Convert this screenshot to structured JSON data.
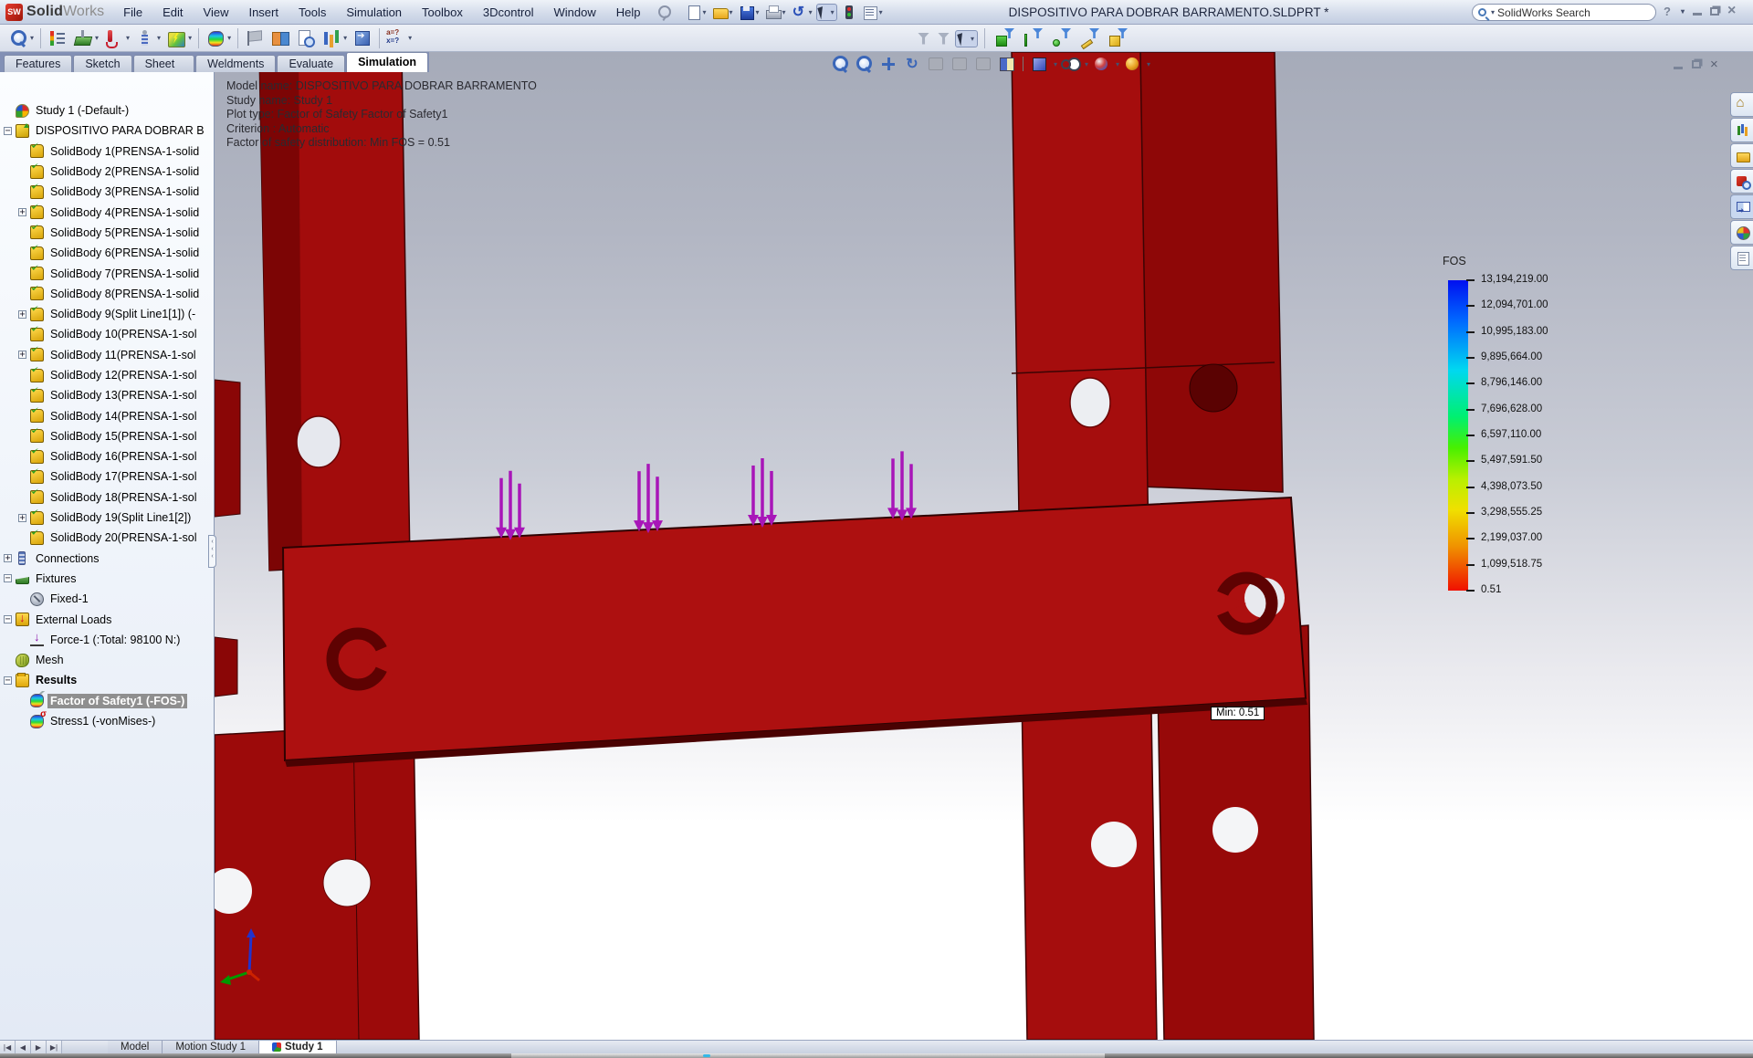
{
  "titlebar": {
    "app_name_bold": "Solid",
    "app_name_light": "Works",
    "menus": [
      "File",
      "Edit",
      "View",
      "Insert",
      "Tools",
      "Simulation",
      "Toolbox",
      "3Dcontrol",
      "Window",
      "Help"
    ],
    "document_title": "DISPOSITIVO PARA DOBRAR BARRAMENTO.SLDPRT *",
    "search_placeholder": "SolidWorks Search",
    "quick_access": [
      {
        "name": "new",
        "caret": true
      },
      {
        "name": "open",
        "caret": true
      },
      {
        "name": "save",
        "caret": true
      },
      {
        "name": "print",
        "caret": true
      },
      {
        "name": "undo",
        "caret": true
      },
      {
        "name": "select",
        "caret": true,
        "pressed": true
      },
      {
        "name": "rebuild",
        "caret": false
      },
      {
        "name": "options",
        "caret": true
      }
    ]
  },
  "command_manager": {
    "sim_toolbar": [
      {
        "name": "study-advisor",
        "caret": true,
        "sep_after": true
      },
      {
        "name": "model-list",
        "caret": false
      },
      {
        "name": "fixtures-advisor",
        "caret": true
      },
      {
        "name": "external-loads-advisor",
        "caret": true
      },
      {
        "name": "connections-advisor",
        "caret": true
      },
      {
        "name": "run-study",
        "caret": true,
        "sep_after": true
      },
      {
        "name": "results-advisor",
        "caret": true,
        "sep_after": true
      },
      {
        "name": "deformed-result",
        "caret": false
      },
      {
        "name": "compare-results",
        "caret": false
      },
      {
        "name": "plot-tools",
        "caret": false
      },
      {
        "name": "report",
        "caret": true
      },
      {
        "name": "include-image",
        "caret": false,
        "sep_after": true
      },
      {
        "name": "equations",
        "caret": true
      }
    ],
    "filter_toolbar": [
      {
        "name": "filter-item",
        "type": "funnel-gray"
      },
      {
        "name": "filter-hierarchy",
        "type": "funnel-gray2"
      },
      {
        "name": "select-cursor",
        "type": "cursor",
        "pressed": true,
        "caret": true,
        "sep_after": true
      },
      {
        "name": "filter-faces",
        "type": "face"
      },
      {
        "name": "filter-edges",
        "type": "edge"
      },
      {
        "name": "filter-vertices",
        "type": "vertex"
      },
      {
        "name": "filter-sketch",
        "type": "sketch"
      },
      {
        "name": "filter-bodies",
        "type": "cube"
      }
    ],
    "tabs": [
      {
        "label": "Features",
        "active": false
      },
      {
        "label": "Sketch",
        "active": false
      },
      {
        "label": "Sheet Metal",
        "active": false
      },
      {
        "label": "Weldments",
        "active": false
      },
      {
        "label": "Evaluate",
        "active": false
      },
      {
        "label": "Simulation",
        "active": true
      }
    ]
  },
  "tree": {
    "items": [
      {
        "label": "Study 1 (-Default-)",
        "level": 0,
        "icon": "study",
        "expand": "none"
      },
      {
        "label": "DISPOSITIVO PARA DOBRAR B",
        "level": 0,
        "icon": "part",
        "expand": "minus"
      },
      {
        "label": "SolidBody 1(PRENSA-1-solid",
        "level": 1,
        "icon": "solidbody",
        "expand": "none"
      },
      {
        "label": "SolidBody 2(PRENSA-1-solid",
        "level": 1,
        "icon": "solidbody",
        "expand": "none"
      },
      {
        "label": "SolidBody 3(PRENSA-1-solid",
        "level": 1,
        "icon": "solidbody",
        "expand": "none"
      },
      {
        "label": "SolidBody 4(PRENSA-1-solid",
        "level": 1,
        "icon": "solidbody",
        "expand": "plus"
      },
      {
        "label": "SolidBody 5(PRENSA-1-solid",
        "level": 1,
        "icon": "solidbody",
        "expand": "none"
      },
      {
        "label": "SolidBody 6(PRENSA-1-solid",
        "level": 1,
        "icon": "solidbody",
        "expand": "none"
      },
      {
        "label": "SolidBody 7(PRENSA-1-solid",
        "level": 1,
        "icon": "solidbody",
        "expand": "none"
      },
      {
        "label": "SolidBody 8(PRENSA-1-solid",
        "level": 1,
        "icon": "solidbody",
        "expand": "none"
      },
      {
        "label": "SolidBody 9(Split Line1[1]) (-",
        "level": 1,
        "icon": "solidbody",
        "expand": "plus"
      },
      {
        "label": "SolidBody 10(PRENSA-1-sol",
        "level": 1,
        "icon": "solidbody",
        "expand": "none"
      },
      {
        "label": "SolidBody 11(PRENSA-1-sol",
        "level": 1,
        "icon": "solidbody",
        "expand": "plus"
      },
      {
        "label": "SolidBody 12(PRENSA-1-sol",
        "level": 1,
        "icon": "solidbody",
        "expand": "none"
      },
      {
        "label": "SolidBody 13(PRENSA-1-sol",
        "level": 1,
        "icon": "solidbody",
        "expand": "none"
      },
      {
        "label": "SolidBody 14(PRENSA-1-sol",
        "level": 1,
        "icon": "solidbody",
        "expand": "none"
      },
      {
        "label": "SolidBody 15(PRENSA-1-sol",
        "level": 1,
        "icon": "solidbody",
        "expand": "none"
      },
      {
        "label": "SolidBody 16(PRENSA-1-sol",
        "level": 1,
        "icon": "solidbody",
        "expand": "none"
      },
      {
        "label": "SolidBody 17(PRENSA-1-sol",
        "level": 1,
        "icon": "solidbody",
        "expand": "none"
      },
      {
        "label": "SolidBody 18(PRENSA-1-sol",
        "level": 1,
        "icon": "solidbody",
        "expand": "none"
      },
      {
        "label": "SolidBody 19(Split Line1[2])",
        "level": 1,
        "icon": "solidbody",
        "expand": "plus"
      },
      {
        "label": "SolidBody 20(PRENSA-1-sol",
        "level": 1,
        "icon": "solidbody",
        "expand": "none"
      },
      {
        "label": "Connections",
        "level": 0,
        "icon": "connections",
        "expand": "plus"
      },
      {
        "label": "Fixtures",
        "level": 0,
        "icon": "fixtures",
        "expand": "minus"
      },
      {
        "label": "Fixed-1",
        "level": 1,
        "icon": "fixed",
        "expand": "none"
      },
      {
        "label": "External Loads",
        "level": 0,
        "icon": "loads",
        "expand": "minus"
      },
      {
        "label": "Force-1 (:Total: 98100 N:)",
        "level": 1,
        "icon": "force",
        "expand": "none"
      },
      {
        "label": "Mesh",
        "level": 0,
        "icon": "mesh",
        "expand": "none"
      },
      {
        "label": "Results",
        "level": 0,
        "icon": "results",
        "expand": "minus",
        "bold": true
      },
      {
        "label": "Factor of Safety1 (-FOS-)",
        "level": 1,
        "icon": "plot-fos",
        "expand": "none",
        "selected": true
      },
      {
        "label": "Stress1 (-vonMises-)",
        "level": 1,
        "icon": "plot-stress",
        "expand": "none"
      }
    ]
  },
  "viewport": {
    "overlay_lines": [
      "Model name: DISPOSITIVO PARA DOBRAR BARRAMENTO",
      "Study name: Study 1",
      "Plot type: Factor of Safety Factor of Safety1",
      "Criterion : Automatic",
      "Factor of safety distribution: Min FOS = 0.51"
    ],
    "min_annotation": "Min: 0.51",
    "legend": {
      "title": "FOS",
      "values": [
        "13,194,219.00",
        "12,094,701.00",
        "10,995,183.00",
        "9,895,664.00",
        "8,796,146.00",
        "7,696,628.00",
        "6,597,110.00",
        "5,497,591.50",
        "4,398,073.50",
        "3,298,555.25",
        "2,199,037.00",
        "1,099,518.75",
        "0.51"
      ]
    },
    "headsup": [
      {
        "name": "zoom-fit",
        "kind": "mag"
      },
      {
        "name": "zoom-area",
        "kind": "mag"
      },
      {
        "name": "pan",
        "kind": "pan"
      },
      {
        "name": "rotate-view",
        "kind": "rotate-view"
      },
      {
        "name": "roll-view",
        "kind": "gray"
      },
      {
        "name": "previous-view",
        "kind": "gray"
      },
      {
        "name": "named-views",
        "kind": "gray"
      },
      {
        "name": "section-view",
        "kind": "section-view",
        "sep_after": true
      },
      {
        "name": "display-style",
        "kind": "display-style",
        "caret": true
      },
      {
        "name": "hide-show-items",
        "kind": "hide-show",
        "caret": true
      },
      {
        "name": "edit-appearance",
        "kind": "edit-appearance",
        "caret": true
      },
      {
        "name": "apply-scene",
        "kind": "apply-scene",
        "caret": true
      }
    ],
    "task_pane": [
      {
        "name": "resources"
      },
      {
        "name": "design-library"
      },
      {
        "name": "file-explorer"
      },
      {
        "name": "search-results"
      },
      {
        "name": "view-palette",
        "pressed": true
      },
      {
        "name": "appearances"
      },
      {
        "name": "custom-properties"
      }
    ]
  },
  "bottom_bar": {
    "tabs": [
      {
        "label": "Model",
        "active": false
      },
      {
        "label": "Motion Study 1",
        "active": false
      },
      {
        "label": "Study 1",
        "active": true
      }
    ]
  }
}
